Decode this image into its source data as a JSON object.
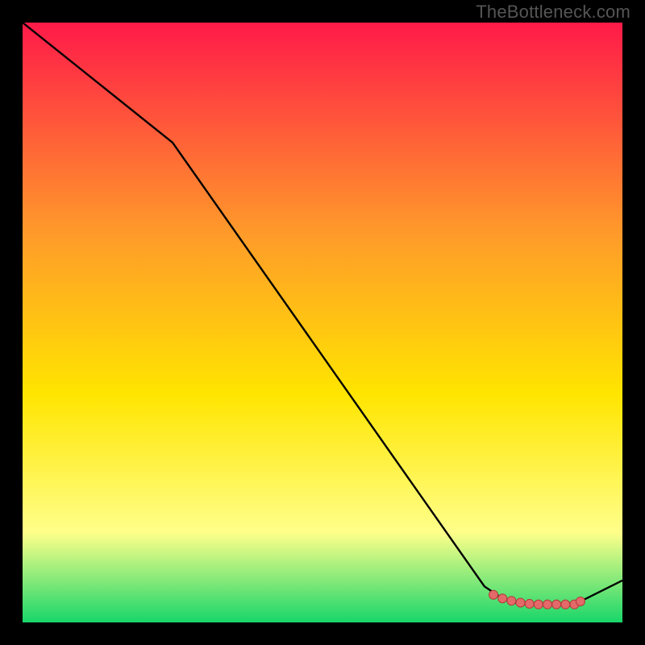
{
  "attribution": "TheBottleneck.com",
  "colors": {
    "line": "#000000",
    "marker_fill": "#e46a6a",
    "marker_stroke": "#b23a3a",
    "gradient_top": "#ff1a49",
    "gradient_mid_upper": "#ff9a2a",
    "gradient_mid": "#ffe500",
    "gradient_lower": "#ffff8a",
    "gradient_bottom": "#18d66a",
    "frame": "#000000"
  },
  "chart_data": {
    "type": "line",
    "title": "",
    "xlabel": "",
    "ylabel": "",
    "xlim": [
      0,
      100
    ],
    "ylim": [
      0,
      100
    ],
    "grid": false,
    "series": [
      {
        "name": "curve",
        "x": [
          0,
          25,
          77,
          80,
          82,
          84,
          86,
          88,
          90,
          92,
          93,
          100
        ],
        "y": [
          100,
          80,
          6,
          4,
          3.3,
          3,
          3,
          3,
          3,
          3,
          3.5,
          7
        ]
      }
    ],
    "markers": {
      "name": "highlight",
      "x": [
        78.5,
        80,
        81.5,
        83,
        84.5,
        86,
        87.5,
        89,
        90.5,
        92,
        93
      ],
      "y": [
        4.6,
        4.0,
        3.6,
        3.3,
        3.1,
        3.0,
        3.0,
        3.0,
        3.0,
        3.0,
        3.5
      ]
    }
  }
}
